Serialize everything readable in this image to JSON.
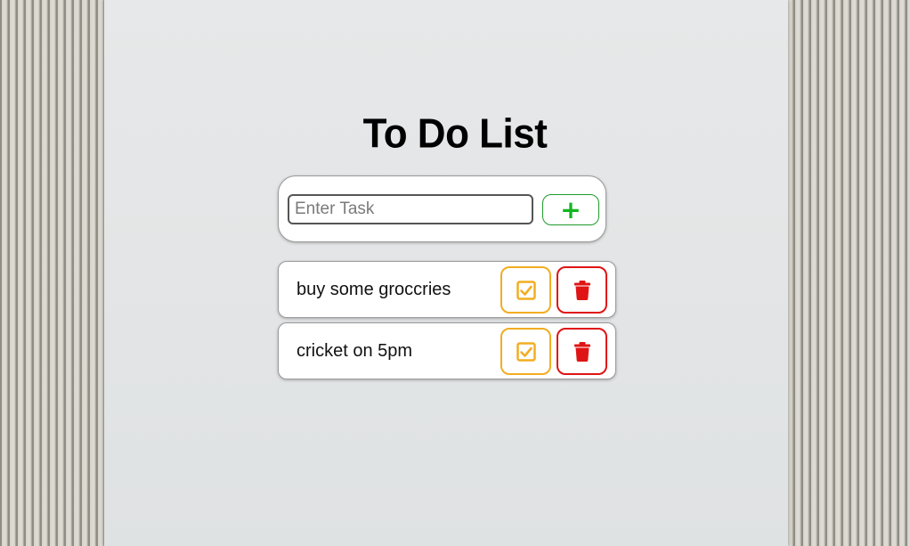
{
  "app": {
    "title": "To Do List"
  },
  "input": {
    "placeholder": "Enter Task",
    "value": "",
    "add_icon": "plus-icon",
    "add_label": "+"
  },
  "tasks": [
    {
      "text": "buy some groccries",
      "check_icon": "check-square-icon",
      "delete_icon": "trash-icon"
    },
    {
      "text": "cricket on 5pm",
      "check_icon": "check-square-icon",
      "delete_icon": "trash-icon"
    }
  ],
  "colors": {
    "add_accent": "#12b51e",
    "check_accent": "#f2ad22",
    "delete_accent": "#e01414"
  }
}
